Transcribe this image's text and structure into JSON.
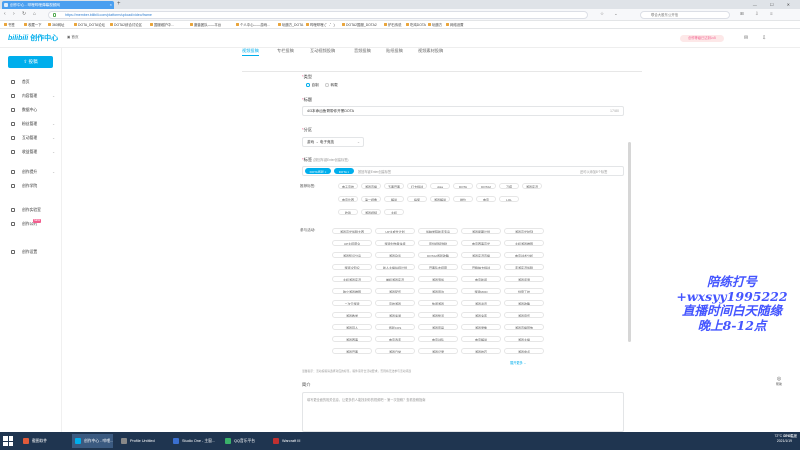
{
  "browser": {
    "tab_title": "创作中心 - 哔哩哔哩弹幕视频网",
    "url": "https://member.bilibili.com/platform/upload/video/frame",
    "search_placeholder": "联合大股东公开信",
    "bookmarks": [
      "书签",
      "收藏一下",
      "360网址",
      "DOTA_DOTA论坛",
      "DOTA2综合讨论区",
      "国服维护中...",
      "魔兽团队——平台",
      "个人中心——游戏...",
      "玩魔方_DOTA",
      "哔哩哔哩 (゜-゜)",
      "DOTA2国服_DOTA2",
      "炉石传说",
      "吃鸡DOTA",
      "玩魔方",
      "网络设置"
    ]
  },
  "header": {
    "logo": "创作中心",
    "home_label": "首页",
    "creator_badge": "创作等级已达到Lv5"
  },
  "sidebar": {
    "upload_label": "投稿",
    "items": [
      {
        "label": "首页",
        "arrow": ""
      },
      {
        "label": "内容管理",
        "arrow": "⌄"
      },
      {
        "label": "数据中心",
        "arrow": ""
      },
      {
        "label": "粉丝管理",
        "arrow": "⌄"
      },
      {
        "label": "互动管理",
        "arrow": "⌄"
      },
      {
        "label": "收益管理",
        "arrow": "⌄"
      },
      {
        "label": "创作提升",
        "arrow": "⌄"
      },
      {
        "label": "创作学院",
        "arrow": ""
      },
      {
        "label": "创作实验室",
        "arrow": ""
      },
      {
        "label": "创作公约",
        "arrow": "",
        "badge": "NEW"
      },
      {
        "label": "创作设置",
        "arrow": ""
      }
    ]
  },
  "tabs": [
    "视频投稿",
    "专栏投稿",
    "互动视频投稿",
    "音频投稿",
    "贴纸投稿",
    "视频素材投稿"
  ],
  "form": {
    "type_label": "类型",
    "type_options": [
      "自制",
      "转载"
    ],
    "title_label": "标题",
    "title_value": "4/3本命凶鱼哥带你开黑DOTA",
    "title_count": "17/80",
    "section_label": "分区",
    "section_value": "游戏 → 电子竞技",
    "tags_label": "标签",
    "tags_hint": "(按回车键Enter创建标签)",
    "tags": [
      "DOTA游戏",
      "DOTA"
    ],
    "tags_input_placeholder": "按回车键Enter创建标签",
    "tags_count": "还可以添加8个标签",
    "recommend_label": "推荐标签:",
    "recommended_tags": [
      "电子竞技",
      "游戏直播",
      "五黑开黑",
      "打卡挑战",
      "dota",
      "DOTA",
      "DOTA2",
      "刀塔",
      "游戏实况",
      "电竞比赛",
      "第一视角",
      "解说",
      "搞笑",
      "游戏解说",
      "排位",
      "电竞",
      "LOL",
      "吃鸡",
      "游戏视频",
      "主机"
    ],
    "activity_label": "参与活动:",
    "activity_tags": [
      "游戏高光剪辑大赛",
      "UP主成长计划",
      "剪映学院新手专享",
      "游戏星期计划",
      "游戏高光时刻",
      "UP主招募令",
      "游戏创作者扶持",
      "原创视频激励",
      "电竞赛事高光",
      "主机游戏推荐",
      "游戏知识分享",
      "游戏杂谈",
      "DOTA2游戏攻略",
      "游戏实况直播",
      "电竞战术分析",
      "游戏冷知识",
      "新人主播扶持计划",
      "开黑队友招募",
      "开箱抽卡挑战",
      "手游实况剪辑",
      "主机游戏实况",
      "单机游戏实况",
      "游戏混剪",
      "电竞新闻",
      "游戏评测",
      "独立游戏推荐",
      "游戏配乐",
      "游戏周边",
      "游戏MOD",
      "创意工坊",
      "二次元游戏",
      "竞技游戏",
      "休闲游戏",
      "游戏资讯",
      "游戏攻略",
      "游戏教学",
      "游戏速通",
      "游戏整活",
      "游戏鬼畜",
      "游戏音乐",
      "游戏同人",
      "游戏COS",
      "游戏原画",
      "游戏录像",
      "游戏直播回放",
      "游戏赛事",
      "电竞选手",
      "电竞战队",
      "电竞解说",
      "游戏主播",
      "游戏开黑",
      "游戏日常",
      "游戏记录",
      "游戏技巧",
      "游戏盘点",
      "游戏推荐",
      "游戏剧情",
      "游戏彩蛋",
      "游戏BUG",
      "游戏吐槽",
      "游戏历史"
    ],
    "more_link": "展开更多 ⌄",
    "activity_hint": "温馨提示：活动投稿请选择对应的标签，稿件需符合活动要求，否则将无法参与活动评选",
    "intro_label": "简介",
    "intro_placeholder": "填写更全面的相关信息，让更多的人能找到你的视频吧 ~ 第一次投稿？查看投稿指南"
  },
  "overlay": [
    "陪练打号",
    "+wxsyy1995222",
    "直播时间白天随缘",
    "晚上8-12点"
  ],
  "float_button": "帮助",
  "taskbar": {
    "items": [
      {
        "label": "截图软件",
        "color": "#e05a3a"
      },
      {
        "label": "创作中心 - 哔哩...",
        "color": "#00aeec"
      },
      {
        "label": "Profile Untitled",
        "color": "#888888"
      },
      {
        "label": "Studio One - 主窗...",
        "color": "#3a6fd0"
      },
      {
        "label": "QQ音乐平台",
        "color": "#3ab26a"
      },
      {
        "label": "Warcraft III",
        "color": "#c03030"
      }
    ],
    "tray_line1": "72°C  CPU温度",
    "time": "20:08",
    "date": "2021/1/19"
  }
}
